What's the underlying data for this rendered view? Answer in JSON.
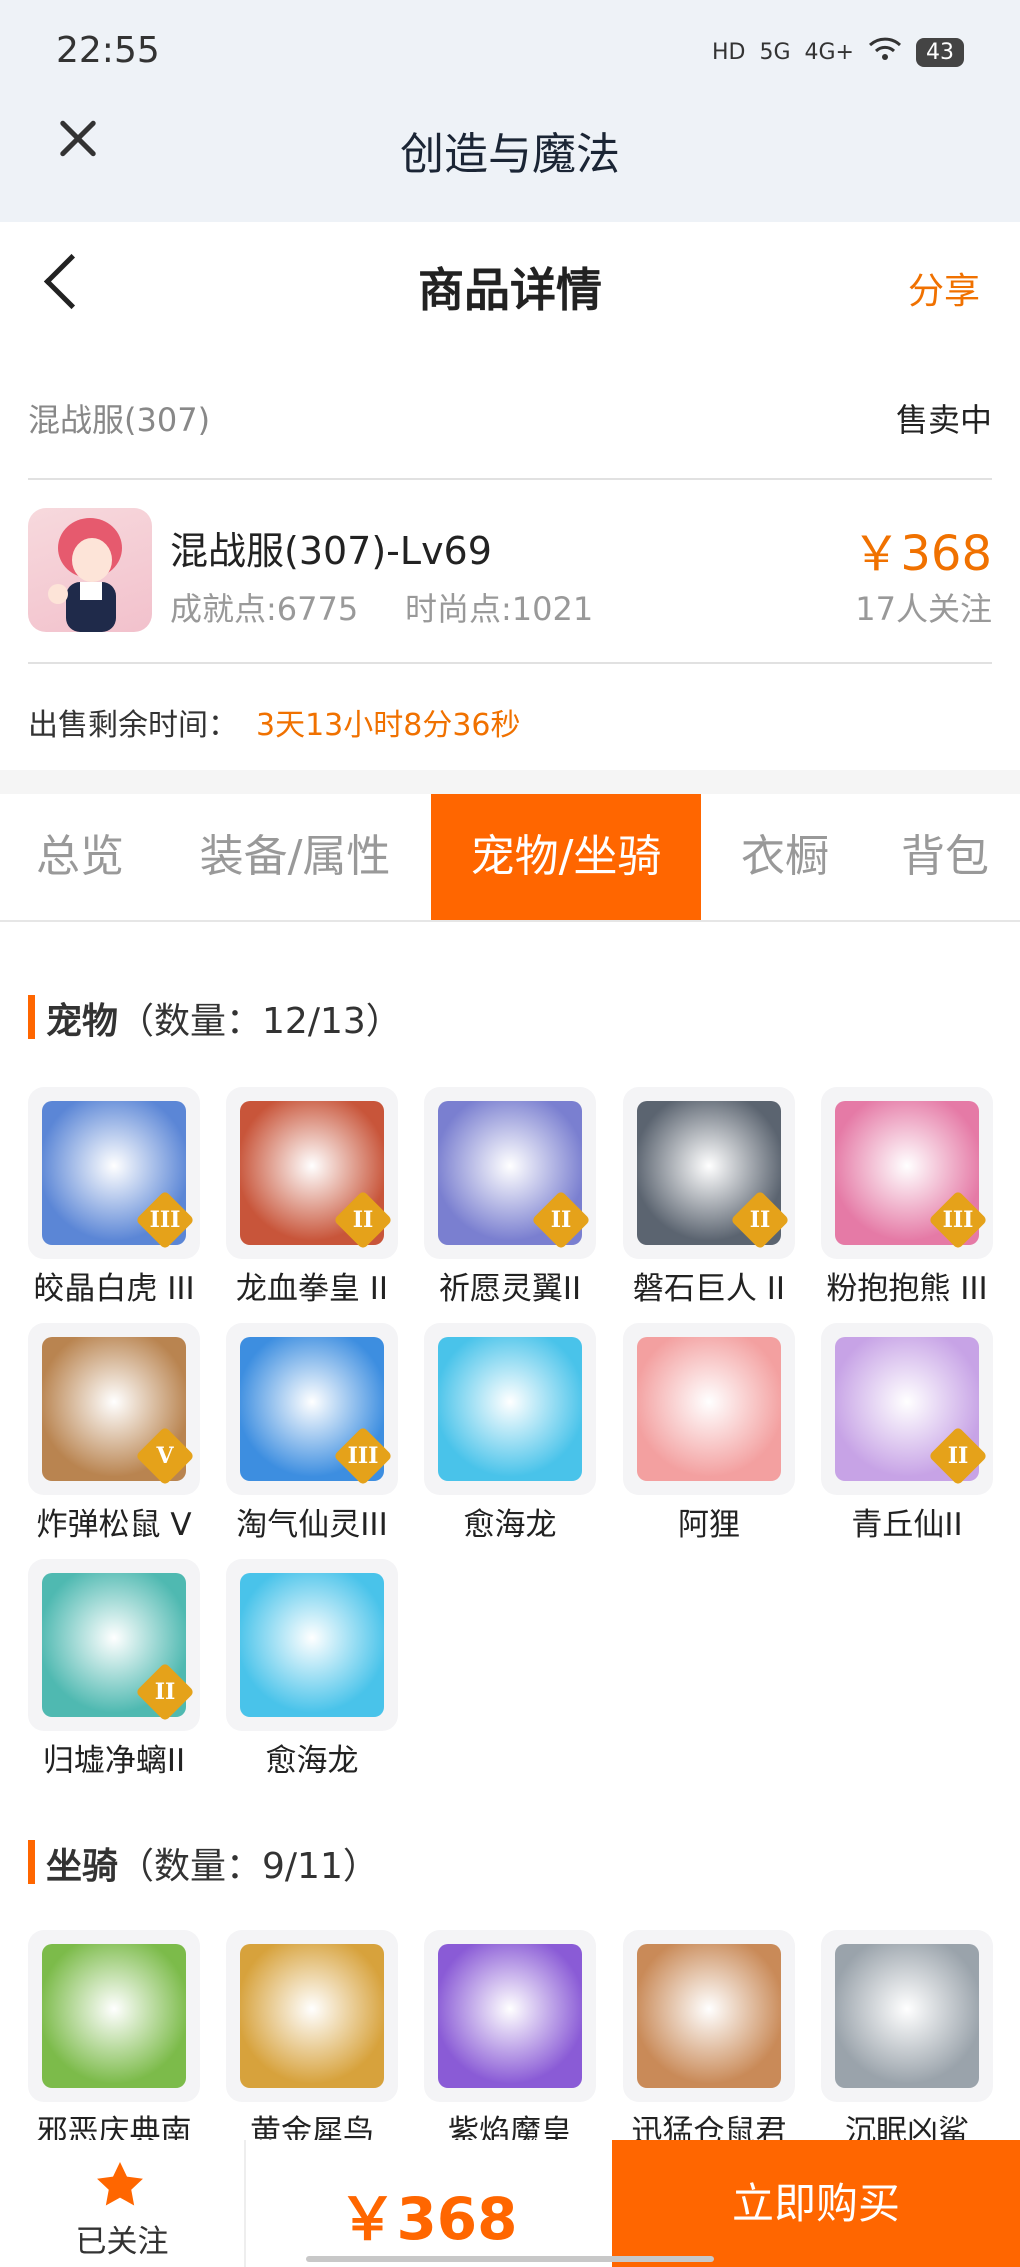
{
  "status_bar": {
    "time": "22:55",
    "icons": [
      "HD",
      "5G",
      "4G+",
      "wifi"
    ],
    "battery": "43"
  },
  "app_bar": {
    "title": "创造与魔法"
  },
  "header": {
    "title": "商品详情",
    "share": "分享"
  },
  "listing": {
    "server": "混战服(307)",
    "status": "售卖中",
    "name": "混战服(307)-Lv69",
    "achievement": "成就点:6775",
    "fashion": "时尚点:1021",
    "price": "￥368",
    "followers": "17人关注",
    "remaining_label": "出售剩余时间：",
    "remaining_value": "3天13小时8分36秒"
  },
  "tabs": [
    {
      "label": "总览"
    },
    {
      "label": "装备/属性"
    },
    {
      "label": "宠物/坐骑",
      "active": true
    },
    {
      "label": "衣橱"
    },
    {
      "label": "背包"
    }
  ],
  "pets": {
    "title": "宠物",
    "count": "（数量：12/13）",
    "items": [
      {
        "name": "皎晶白虎 III",
        "badge": "III",
        "color": "#5b86d6"
      },
      {
        "name": "龙血拳皇 II",
        "badge": "II",
        "color": "#c8553a"
      },
      {
        "name": "祈愿灵翼II",
        "badge": "II",
        "color": "#7a7fd0"
      },
      {
        "name": "磐石巨人 II",
        "badge": "II",
        "color": "#5b6470"
      },
      {
        "name": "粉抱抱熊 III",
        "badge": "III",
        "color": "#e57aa6"
      },
      {
        "name": "炸弹松鼠 V",
        "badge": "V",
        "color": "#b98450"
      },
      {
        "name": "淘气仙灵III",
        "badge": "III",
        "color": "#3d8ee0"
      },
      {
        "name": "愈海龙",
        "badge": "",
        "color": "#49c3ea"
      },
      {
        "name": "阿狸",
        "badge": "",
        "color": "#f3a0a0"
      },
      {
        "name": "青丘仙II",
        "badge": "II",
        "color": "#c7a3e6"
      },
      {
        "name": "归墟净螭II",
        "badge": "II",
        "color": "#4fb9b1"
      },
      {
        "name": "愈海龙",
        "badge": "",
        "color": "#49c3ea"
      }
    ]
  },
  "mounts": {
    "title": "坐骑",
    "count": "（数量：9/11）",
    "items": [
      {
        "name": "邪恶庆典南",
        "color": "#7cbb4a"
      },
      {
        "name": "黄金犀鸟",
        "color": "#d7a23c"
      },
      {
        "name": "紫焰魔皇",
        "color": "#8a5bd6"
      },
      {
        "name": "迅猛仓鼠君",
        "color": "#c98a58"
      },
      {
        "name": "沉眠凶鲨",
        "color": "#9aa3ab"
      }
    ]
  },
  "bottom_bar": {
    "follow_label": "已关注",
    "price": "￥368",
    "buy_label": "立即购买"
  },
  "colors": {
    "accent": "#ff6600",
    "price_text": "#f07100",
    "badge": "#e5a21a"
  }
}
